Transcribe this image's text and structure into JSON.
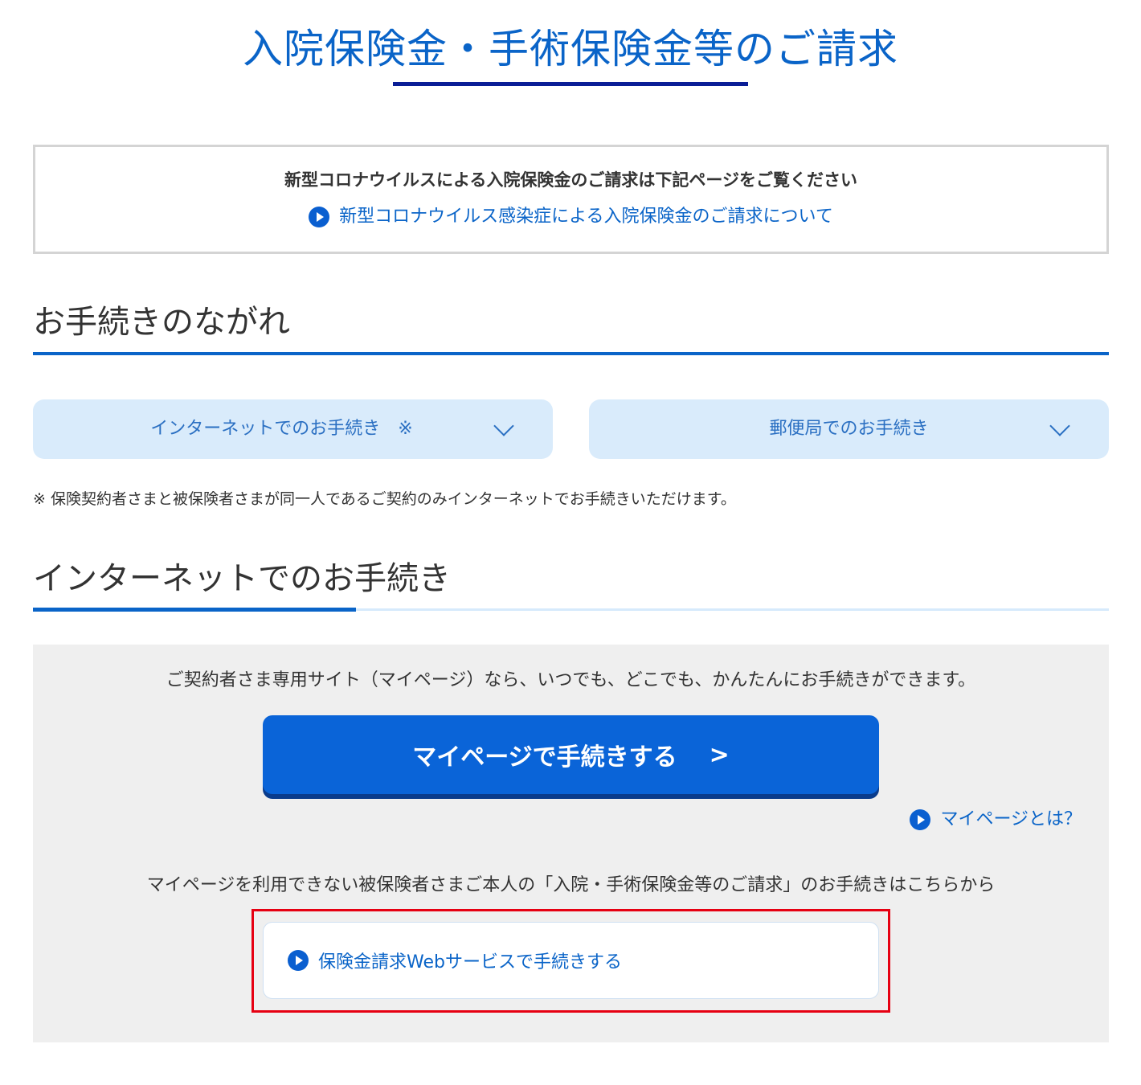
{
  "header": {
    "title": "入院保険金・手術保険金等のご請求"
  },
  "notice": {
    "text": "新型コロナウイルスによる入院保険金のご請求は下記ページをご覧ください",
    "link_label": "新型コロナウイルス感染症による入院保険金のご請求について"
  },
  "flow_section": {
    "heading": "お手続きのながれ",
    "accordions": [
      {
        "label": "インターネットでのお手続き　※"
      },
      {
        "label": "郵便局でのお手続き"
      }
    ],
    "footnote": "※ 保険契約者さまと被保険者さまが同一人であるご契約のみインターネットでお手続きいただけます。"
  },
  "internet_section": {
    "heading": "インターネットでのお手続き",
    "lead": "ご契約者さま専用サイト（マイページ）なら、いつでも、どこでも、かんたんにお手続きができます。",
    "mypage_button": {
      "label": "マイページで手続きする",
      "arrow": ">"
    },
    "mypage_about_link": "マイページとは？",
    "note": "マイページを利用できない被保険者さまご本人の「入院・手術保険金等のご請求」のお手続きはこちらから",
    "web_service_link": "保険金請求Webサービスで手続きする"
  },
  "colors": {
    "brand_blue": "#0a64c8",
    "button_blue": "#0a64d8",
    "accordion_bg": "#d9ebfb",
    "highlight_red": "#e60012",
    "panel_gray": "#efefef"
  }
}
